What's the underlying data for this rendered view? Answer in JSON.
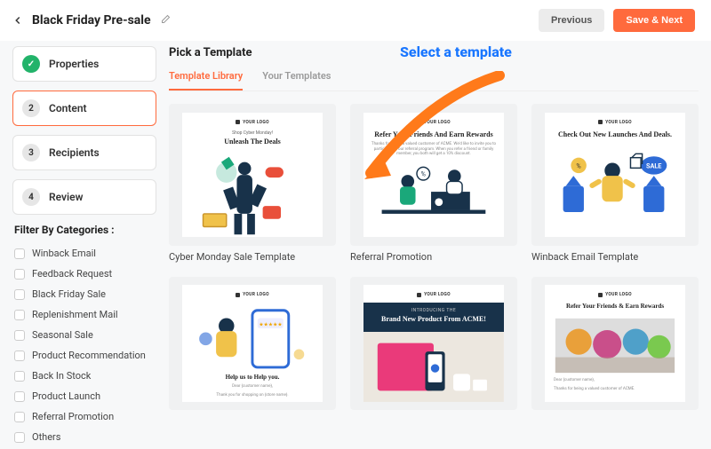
{
  "header": {
    "title": "Black Friday Pre-sale",
    "previous_label": "Previous",
    "save_next_label": "Save & Next"
  },
  "steps": [
    {
      "num": "✓",
      "label": "Properties",
      "done": true,
      "active": false
    },
    {
      "num": "2",
      "label": "Content",
      "done": false,
      "active": true
    },
    {
      "num": "3",
      "label": "Recipients",
      "done": false,
      "active": false
    },
    {
      "num": "4",
      "label": "Review",
      "done": false,
      "active": false
    }
  ],
  "filter": {
    "title": "Filter By Categories :",
    "items": [
      "Winback Email",
      "Feedback Request",
      "Black Friday Sale",
      "Replenishment Mail",
      "Seasonal Sale",
      "Product Recommendation",
      "Back In Stock",
      "Product Launch",
      "Referral Promotion",
      "Others"
    ]
  },
  "section": {
    "title": "Pick a Template",
    "tabs": [
      "Template Library",
      "Your Templates"
    ],
    "active_tab": 0
  },
  "annotation": "Select a template",
  "templates_row1": [
    {
      "label": "Cyber Monday Sale Template",
      "logo": "YOUR LOGO",
      "sub": "Shop Cyber Monday!",
      "headline": "Unleash The Deals"
    },
    {
      "label": "Referral Promotion",
      "logo": "YOUR LOGO",
      "headline": "Refer Your Friends And Earn Rewards",
      "body": "Thanks for being a valued customer of ACME. We'd like to invite you to participate in our referral program. When you refer a friend or family member, you both will get a 10% discount."
    },
    {
      "label": "Winback Email Template",
      "logo": "YOUR LOGO",
      "headline": "Check Out New Launches And Deals."
    }
  ],
  "templates_row2": [
    {
      "logo": "YOUR LOGO",
      "headline": "Help us to Help you.",
      "body_lines": [
        "Dear {customer name},",
        "Thank you for shopping on {store name}."
      ]
    },
    {
      "logo": "YOUR LOGO",
      "sub": "INTRODUCING THE",
      "headline": "Brand New Product From ACME!"
    },
    {
      "logo": "YOUR LOGO",
      "headline": "Refer Your Friends & Earn Rewards",
      "body_lines": [
        "Dear {customer name},",
        "Thanks for being a valued customer of ACME."
      ]
    }
  ]
}
